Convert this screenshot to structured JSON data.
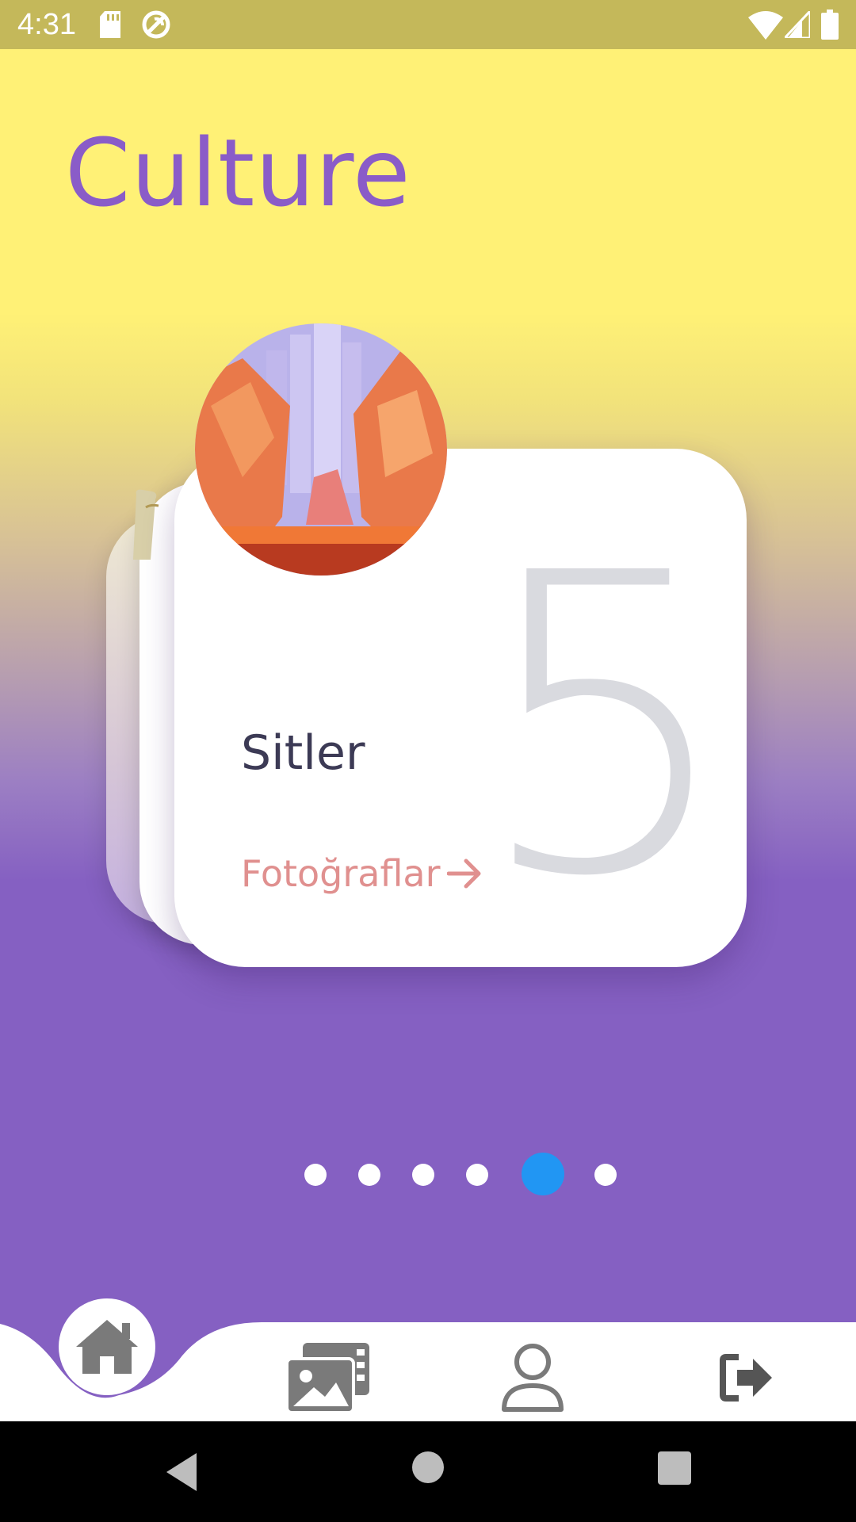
{
  "status_bar": {
    "time": "4:31",
    "icons": [
      "sd-card-icon",
      "sync-icon",
      "wifi-icon",
      "signal-icon",
      "battery-icon"
    ]
  },
  "page": {
    "title": "Culture"
  },
  "carousel": {
    "active_card": {
      "number": "5",
      "title": "Sitler",
      "link_label": "Fotoğraflar",
      "link_icon": "arrow-right-icon",
      "image": "canyon-illustration"
    },
    "page_count": 6,
    "active_index": 4
  },
  "bottom_nav": {
    "items": [
      {
        "name": "home",
        "icon": "home-icon",
        "active": true
      },
      {
        "name": "gallery",
        "icon": "gallery-icon",
        "active": false
      },
      {
        "name": "profile",
        "icon": "person-icon",
        "active": false
      },
      {
        "name": "logout",
        "icon": "logout-icon",
        "active": false
      }
    ]
  },
  "colors": {
    "accent": "#8a5cc8",
    "background_top": "#fff176",
    "background_bottom": "#8560c2",
    "dot_active": "#2196f3",
    "link": "#e0908f"
  }
}
